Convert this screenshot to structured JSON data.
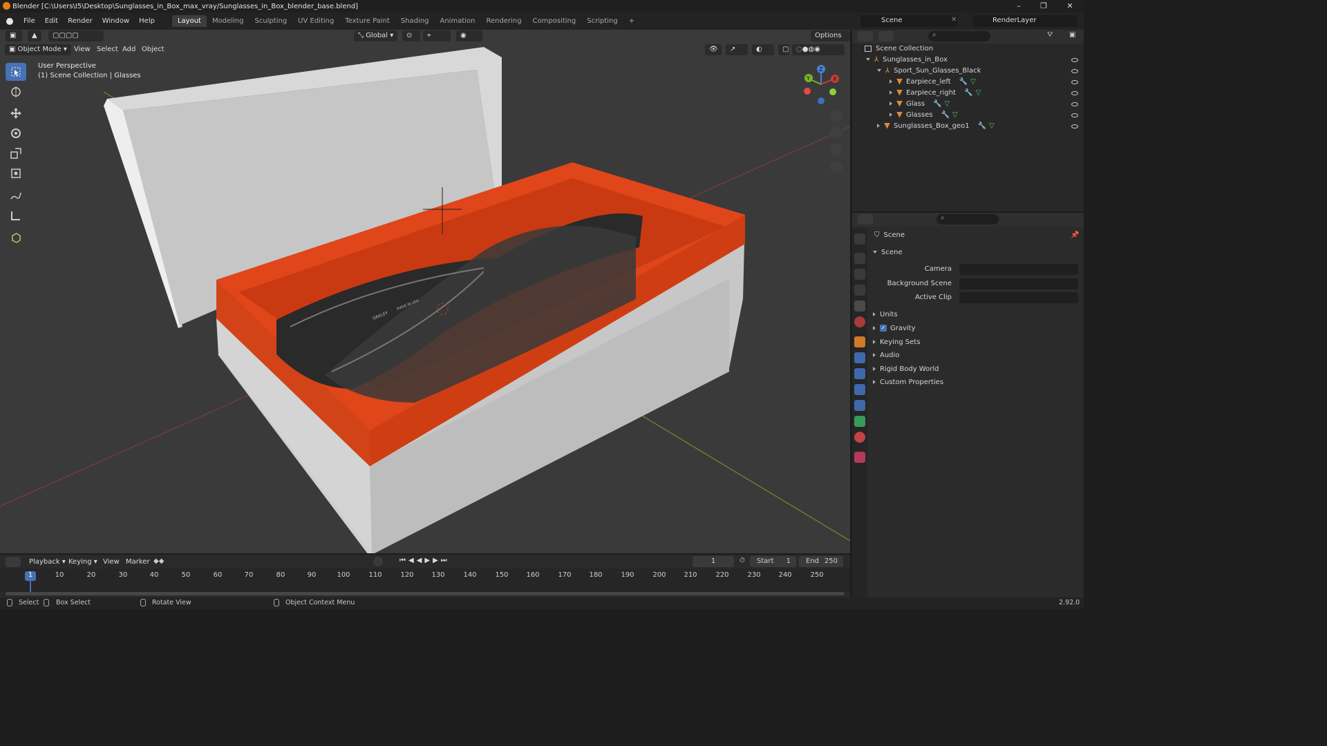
{
  "window": {
    "title": "Blender [C:\\Users\\I5\\Desktop\\Sunglasses_in_Box_max_vray/Sunglasses_in_Box_blender_base.blend]",
    "minimize": "–",
    "maximize": "❐",
    "close": "✕"
  },
  "menus": [
    "File",
    "Edit",
    "Render",
    "Window",
    "Help"
  ],
  "workspaces": [
    "Layout",
    "Modeling",
    "Sculpting",
    "UV Editing",
    "Texture Paint",
    "Shading",
    "Animation",
    "Rendering",
    "Compositing",
    "Scripting",
    "+"
  ],
  "active_workspace": "Layout",
  "scene_name": "Scene",
  "view_layer": "RenderLayer",
  "viewport": {
    "mode": "Object Mode",
    "header_menus": [
      "View",
      "Select",
      "Add",
      "Object"
    ],
    "transform_orientation": "Global",
    "options_label": "Options",
    "overlay_line1": "User Perspective",
    "overlay_line2": "(1) Scene Collection | Glasses",
    "gizmo_labels": {
      "x": "X",
      "y": "Y",
      "z": "Z"
    },
    "object_texts": {
      "brand": "OAKLEY",
      "made": "MADE IN USA"
    }
  },
  "outliner": {
    "root": "Scene Collection",
    "items": [
      {
        "label": "Sunglasses_in_Box",
        "depth": 1,
        "expanded": true,
        "kind": "collection"
      },
      {
        "label": "Sport_Sun_Glasses_Black",
        "depth": 2,
        "expanded": true,
        "kind": "collection"
      },
      {
        "label": "Earpiece_left",
        "depth": 3,
        "expanded": false,
        "kind": "mesh"
      },
      {
        "label": "Earpiece_right",
        "depth": 3,
        "expanded": false,
        "kind": "mesh"
      },
      {
        "label": "Glass",
        "depth": 3,
        "expanded": false,
        "kind": "mesh"
      },
      {
        "label": "Glasses",
        "depth": 3,
        "expanded": false,
        "kind": "mesh"
      },
      {
        "label": "Sunglasses_Box_geo1",
        "depth": 2,
        "expanded": false,
        "kind": "mesh"
      }
    ]
  },
  "properties": {
    "context": "Scene",
    "panel_title": "Scene",
    "fields": [
      {
        "label": "Camera",
        "value": ""
      },
      {
        "label": "Background Scene",
        "value": ""
      },
      {
        "label": "Active Clip",
        "value": ""
      }
    ],
    "sections": [
      {
        "label": "Units",
        "checkbox": false
      },
      {
        "label": "Gravity",
        "checkbox": true
      },
      {
        "label": "Keying Sets",
        "checkbox": false
      },
      {
        "label": "Audio",
        "checkbox": false
      },
      {
        "label": "Rigid Body World",
        "checkbox": false
      },
      {
        "label": "Custom Properties",
        "checkbox": false
      }
    ]
  },
  "timeline": {
    "menus": [
      "Playback",
      "Keying",
      "View",
      "Marker"
    ],
    "current_frame": "1",
    "start_label": "Start",
    "start": "1",
    "end_label": "End",
    "end": "250",
    "ticks": [
      "1",
      "10",
      "20",
      "30",
      "40",
      "50",
      "60",
      "70",
      "80",
      "90",
      "100",
      "110",
      "120",
      "130",
      "140",
      "150",
      "160",
      "170",
      "180",
      "190",
      "200",
      "210",
      "220",
      "230",
      "240",
      "250"
    ]
  },
  "status": {
    "select": "Select",
    "box_select": "Box Select",
    "rotate_view": "Rotate View",
    "context_menu": "Object Context Menu",
    "version": "2.92.0"
  },
  "colors": {
    "accent": "#4772b3",
    "box_inner": "#e0461a",
    "box_outer": "#d2d2d2",
    "grid": "#3a3a3a"
  }
}
